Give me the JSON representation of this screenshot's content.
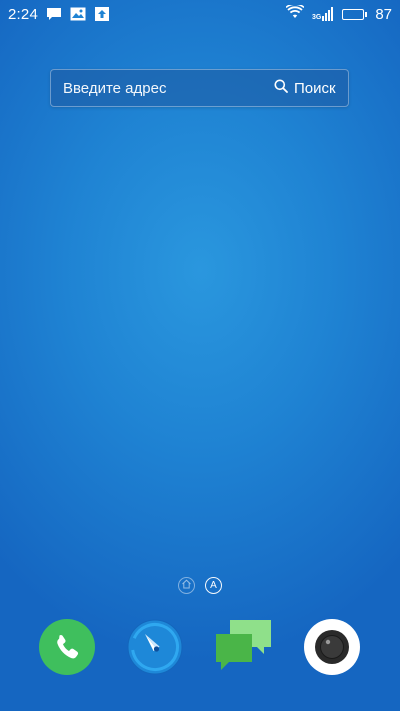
{
  "status_bar": {
    "time": "2:24",
    "notification_icons": [
      "message-icon",
      "image-icon",
      "upload-icon"
    ],
    "network_label": "3G",
    "battery_percent": "87",
    "battery_level": 0.87
  },
  "search_widget": {
    "address_placeholder": "Введите адрес",
    "search_label": "Поиск"
  },
  "page_indicator": {
    "home_icon": "home-icon",
    "active_page_label": "A"
  },
  "dock": {
    "apps": [
      {
        "name": "phone",
        "icon": "phone-icon",
        "color": "#3fbf5d"
      },
      {
        "name": "browser",
        "icon": "compass-icon",
        "color": "#1e88d8"
      },
      {
        "name": "messages",
        "icon": "chat-bubbles-icon",
        "color": "#4fc24a"
      },
      {
        "name": "camera",
        "icon": "camera-icon",
        "color": "#ffffff"
      }
    ]
  },
  "colors": {
    "wallpaper_center": "#2a97de",
    "wallpaper_edge": "#1566c1"
  }
}
